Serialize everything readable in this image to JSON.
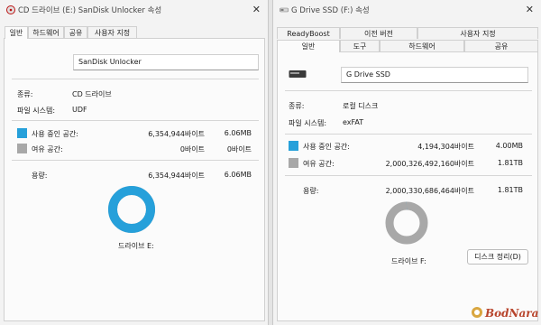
{
  "left": {
    "title": "CD 드라이브 (E:) SanDisk Unlocker 속성",
    "tabs": [
      "일반",
      "하드웨어",
      "공유",
      "사용자 지정"
    ],
    "name_value": "SanDisk Unlocker",
    "type_label": "종류:",
    "type_value": "CD 드라이브",
    "fs_label": "파일 시스템:",
    "fs_value": "UDF",
    "used_label": "사용 중인 공간:",
    "used_bytes": "6,354,944바이트",
    "used_size": "6.06MB",
    "free_label": "여유 공간:",
    "free_bytes": "0바이트",
    "free_size": "0바이트",
    "capacity_label": "용량:",
    "capacity_bytes": "6,354,944바이트",
    "capacity_size": "6.06MB",
    "drive_caption": "드라이브 E:",
    "used_fraction": 1.0,
    "used_color": "#26a0da",
    "free_color": "#a8a8a8"
  },
  "right": {
    "title": "G Drive SSD (F:) 속성",
    "tabs_row1": [
      "ReadyBoost",
      "이전 버전",
      "사용자 지정"
    ],
    "tabs_row2": [
      "일반",
      "도구",
      "하드웨어",
      "공유"
    ],
    "name_value": "G Drive SSD",
    "type_label": "종류:",
    "type_value": "로컬 디스크",
    "fs_label": "파일 시스템:",
    "fs_value": "exFAT",
    "used_label": "사용 중인 공간:",
    "used_bytes": "4,194,304바이트",
    "used_size": "4.00MB",
    "free_label": "여유 공간:",
    "free_bytes": "2,000,326,492,160바이트",
    "free_size": "1.81TB",
    "capacity_label": "용량:",
    "capacity_bytes": "2,000,330,686,464바이트",
    "capacity_size": "1.81TB",
    "drive_caption": "드라이브 F:",
    "cleanup_button": "디스크 정리(D)",
    "used_fraction": 2.1e-06,
    "used_color": "#26a0da",
    "free_color": "#a8a8a8"
  },
  "watermark": "BodNara",
  "icons": {
    "left_title": "cd-drive-icon",
    "right_title": "drive-icon",
    "right_drive": "ssd-drive-icon",
    "close": "close-icon"
  }
}
